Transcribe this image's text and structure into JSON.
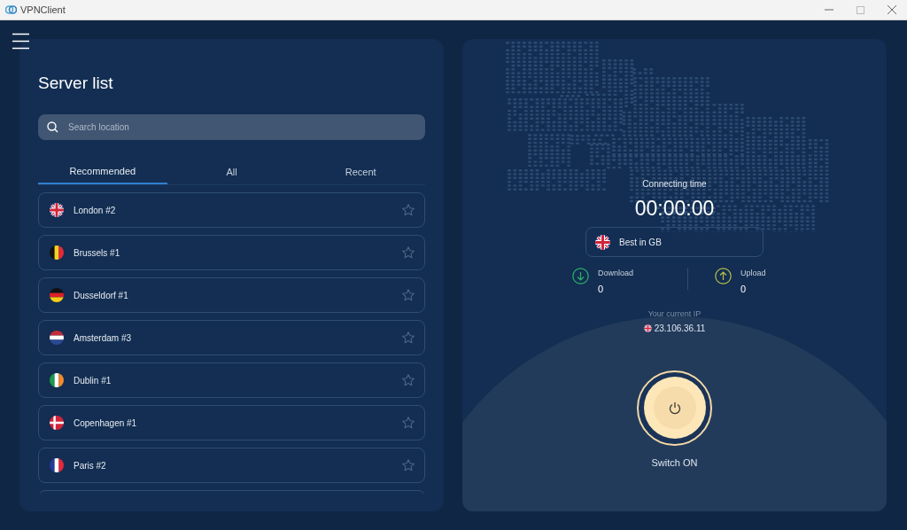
{
  "window": {
    "title": "VPNClient"
  },
  "server_list": {
    "title": "Server list",
    "search": {
      "placeholder": "Search location"
    },
    "tabs": [
      {
        "label": "Recommended",
        "selected": true
      },
      {
        "label": "All",
        "selected": false
      },
      {
        "label": "Recent",
        "selected": false
      }
    ],
    "servers": [
      {
        "name": "London #2",
        "kind": "gb",
        "favorite": false
      },
      {
        "name": "Brussels #1",
        "kind": "be",
        "favorite": false
      },
      {
        "name": "Dusseldorf #1",
        "kind": "de",
        "favorite": false
      },
      {
        "name": "Amsterdam #3",
        "kind": "nl",
        "favorite": false
      },
      {
        "name": "Dublin #1",
        "kind": "ie",
        "favorite": false
      },
      {
        "name": "Copenhagen #1",
        "kind": "dk",
        "favorite": false
      },
      {
        "name": "Paris #2",
        "kind": "fr",
        "favorite": false
      }
    ]
  },
  "connection": {
    "time_label": "Connecting time",
    "time": "00:00:00",
    "location": {
      "name": "Best in GB",
      "kind": "gb"
    },
    "download": {
      "label": "Download",
      "value": "0"
    },
    "upload": {
      "label": "Upload",
      "value": "0"
    },
    "current_ip": {
      "label": "Your current IP",
      "value": "23.106.36.11",
      "kind": "gb"
    },
    "power": {
      "label": "Switch ON",
      "on": false
    }
  }
}
